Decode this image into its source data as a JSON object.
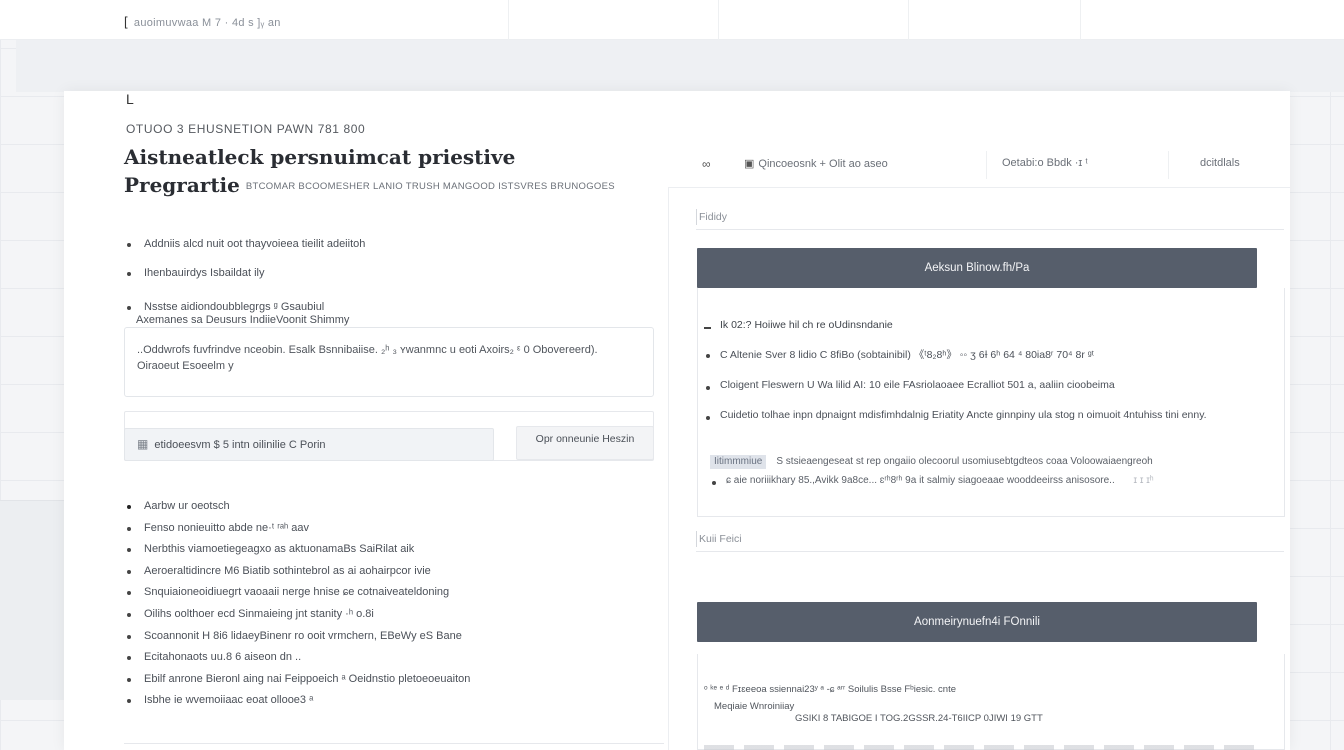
{
  "topbar": {
    "breadcrumb_mark": "[",
    "breadcrumb": "auoimuvwaa M 7 · 4d s ]ᵧ an"
  },
  "card": {
    "corner_mark": "L",
    "kicker": "OTUOO 3 EHUSNETION PAWN 781 800",
    "title_line1": "Aistneatleck  persnuimcat  priestive",
    "title_line2": "Pregrartie",
    "title_sub": "BTCOMAR BCOOMESHER LANIO TRUSH MANGOOD ISTSVRES BRUNOGOES"
  },
  "left": {
    "list_a": [
      "Addniis alcd nuit oot thayvoieea tieilit adeiitoh",
      "Ihenbauirdys Isbaildat ily",
      "Nsstse aidiondoubblegrgs ᵍ Gsaubiul"
    ],
    "info_head": "Axemanes sa Deusurs IndiieVoonit Shimmy",
    "info_text_1": "..Oddwrofs fuvfrindve nceobin.  Esalk Bsnnibaiise. ₂ʰ ₃ ʏwanmnc u eoti  Axoirs₂ ᵋ  0 Obovereerd).",
    "info_text_2": "Oiraoeut Esoeelm y",
    "search_value": "etidoeesvm  $ 5 intn oilinilie C Porin",
    "search_button": "Opr onneunie  Heszin",
    "list_b": [
      "Aarbw ur oeotsch",
      "Fenso nonieuitto abde ne·ᵗ ʳᵃʰ aav",
      "Nerbthis viamoetiegeagxo as aktuonamaBs SaiRilat aik",
      "Aeroeraltidincre M6 Biatib sothintebrol as ai aohairpcor ivie",
      "Snquiaioneoidiuegrt vaoaaii nerge hnise ɕe cotnaiveateldoning",
      "Oilihs oolthoer ecd Sinmaieing jnt stanity  ·ʰ  o.8i",
      "Scoannonit H 8i6 lidaeyBinenr ro ooit vrmchern, EBeWy    eS Bane",
      "Ecitahonaots uu.8 6 aiseon dn ..",
      "Ebilf anrone Bieronl aing nai Feippoeich     ᵃ Oeidnstio pletoeoeuaiton",
      "Isbhe ie wvemoiiaac eoat ollooe3 ᵃ"
    ]
  },
  "right": {
    "toolbar": {
      "icon_label": "∞",
      "item1": "Qincoeosnk  +  Olit ao aseo",
      "item2": "Oetabi:o  Bbdk ·ɪ ᵗ",
      "item3": "dcitdlals"
    },
    "field1_label": "Fididy",
    "section1_title": "Aeksun Blinow.fh/Pa",
    "section1_head": "Ik 02:? Hoiiwe hil ch re oUdinsndanie",
    "section1_items": [
      "C Altenie Sver 8 lidio C 8fiBo (sobtainibil) 《ᵗ8₂8ʰ》 ◦◦ ʒ 6Ɨ 6ʰ 64 ⁴ 80ia8ʳ 70⁴ 8r ᵍᵗ",
      "Cloigent Fleswern U Wa lilid AI: 10 eile FAsriolaoaee Ecralliot 501 a, aaliin cioobeima",
      "Cuidetio tolhae inpn dpnaignt mdisfimhdalnig Eriatity Ancte ginnpiny ula stog n oimuoit 4ntuhiss tini enny."
    ],
    "note_tag": "Iitimmmiue",
    "note_text": "S stsieaengeseat st rep ongaiio  olecoorul  usomiusebtgdteos coaa Voloowaiaengreoh",
    "note2_text": "ɕ aie noriiikhary 85.,Avikk 9a8ce... ɛʳʰ8ʳʰ 9a it salmiy siagoeaae wooddeeirss  anisosore..",
    "note2_fade": "ɪ ɪ ɪʰ",
    "field2_label": "Kuii Feici",
    "section2_title": "Aonmeirynuefn4i FOnnili",
    "address_line1": "ᵒ ᵏᵉ ᵉ ᵈ Fɪɛeeoa ssiennai23ʸ ᵃ    -ɕ ᵃʳʳ      Soilulis Bsse Fᵇiesic. cnte",
    "address_line2": "Meqiaie Wnroiniiay",
    "address_line3": "GSIKI 8 TABIGOE I TOG.2GSSR.24-T6IICP 0JIWI 19 GTT"
  }
}
